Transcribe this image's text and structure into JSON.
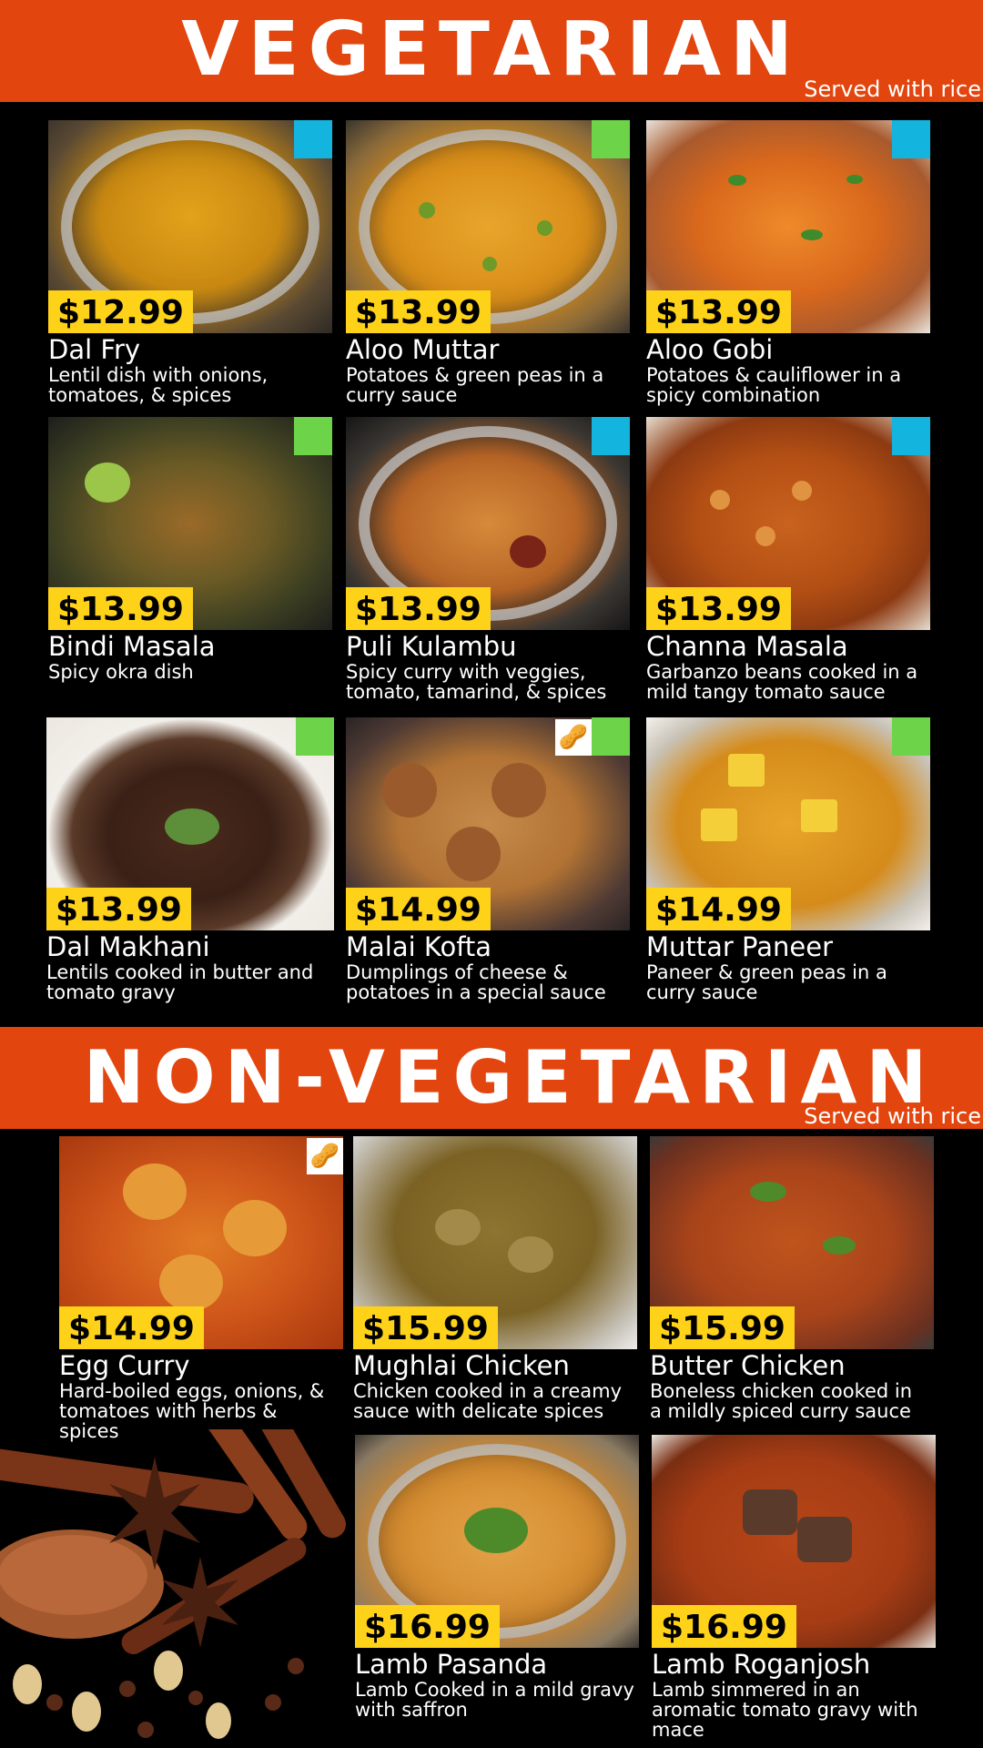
{
  "vegetarian": {
    "title": "VEGETARIAN",
    "subtitle": "Served with rice",
    "items": [
      {
        "name": "Dal Fry",
        "price": "$12.99",
        "desc": "Lentil dish with onions,\ntomatoes, & spices"
      },
      {
        "name": "Aloo Muttar",
        "price": "$13.99",
        "desc": "Potatoes & green peas in a\ncurry sauce"
      },
      {
        "name": "Aloo Gobi",
        "price": "$13.99",
        "desc": "Potatoes & cauliflower in a\nspicy combination"
      },
      {
        "name": "Bindi Masala",
        "price": "$13.99",
        "desc": "Spicy okra dish"
      },
      {
        "name": "Puli Kulambu",
        "price": "$13.99",
        "desc": "Spicy curry with veggies,\ntomato, tamarind, & spices"
      },
      {
        "name": "Channa Masala",
        "price": "$13.99",
        "desc": "Garbanzo beans cooked in a\nmild tangy tomato sauce"
      },
      {
        "name": "Dal Makhani",
        "price": "$13.99",
        "desc": "Lentils cooked in butter and\ntomato gravy"
      },
      {
        "name": "Malai Kofta",
        "price": "$14.99",
        "desc": "Dumplings of cheese &\npotatoes in a special sauce"
      },
      {
        "name": "Muttar Paneer",
        "price": "$14.99",
        "desc": "Paneer & green peas in a\ncurry sauce"
      }
    ]
  },
  "non_vegetarian": {
    "title": "NON-VEGETARIAN",
    "subtitle": "Served with rice",
    "items": [
      {
        "name": "Egg Curry",
        "price": "$14.99",
        "desc": "Hard-boiled eggs, onions, &\ntomatoes with herbs &\nspices"
      },
      {
        "name": "Mughlai Chicken",
        "price": "$15.99",
        "desc": "Chicken cooked in a creamy\nsauce with delicate spices"
      },
      {
        "name": "Butter Chicken",
        "price": "$15.99",
        "desc": "Boneless chicken cooked in\na mildly spiced curry sauce"
      },
      {
        "name": "Lamb Pasanda",
        "price": "$16.99",
        "desc": "Lamb Cooked in a mild gravy\nwith saffron"
      },
      {
        "name": "Lamb Roganjosh",
        "price": "$16.99",
        "desc": "Lamb simmered in an\naromatic tomato gravy with\nmace"
      }
    ]
  },
  "icons": {
    "peanut": "🥜",
    "tag_colors": {
      "blue": "#13b4de",
      "green": "#6dd44a"
    }
  },
  "colors": {
    "banner": "#e2450e",
    "price_bg": "#ffd21a",
    "background": "#000000"
  }
}
